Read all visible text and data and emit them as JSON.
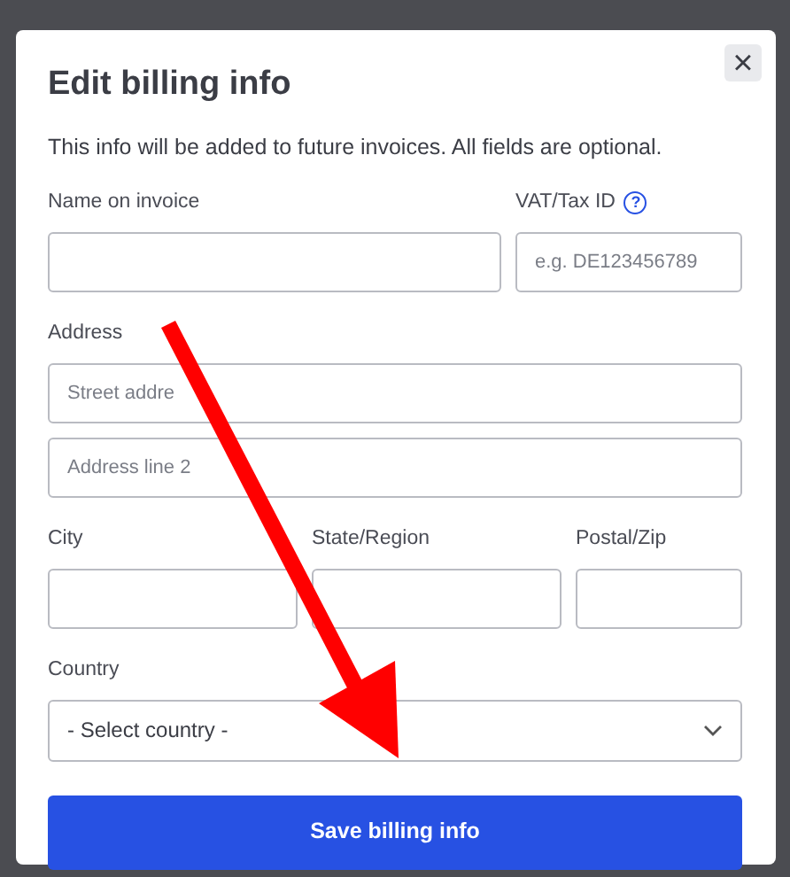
{
  "dialog": {
    "title": "Edit billing info",
    "close_glyph": "×",
    "description": "This info will be added to future invoices. All fields are optional."
  },
  "rows": [
    {
      "fields": [
        {
          "label": "Name on invoice"
        },
        {
          "label": "VAT/Tax ID",
          "help": "?",
          "placeholder": "e.g. DE123456789"
        }
      ]
    },
    {
      "label": "Address",
      "inputs": [
        {
          "placeholder": "Street addre"
        },
        {
          "placeholder": "Address line 2"
        }
      ]
    },
    {
      "fields": [
        {
          "label": "City"
        },
        {
          "label": "State/Region"
        },
        {
          "label": "Postal/Zip"
        }
      ]
    }
  ],
  "country": {
    "label": "Country",
    "value": "- Select country -"
  },
  "save_button": "Save billing info"
}
